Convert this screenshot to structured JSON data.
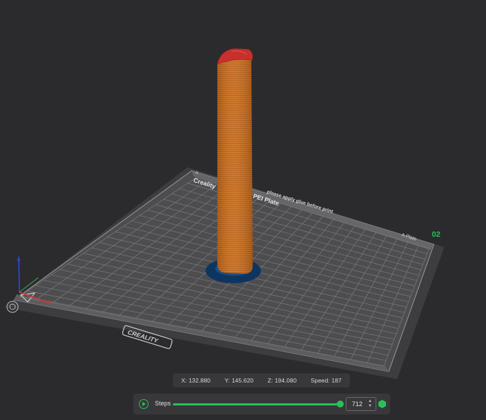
{
  "plate": {
    "brand_top": "Creality",
    "brand_top_suffix": "PEI Plate",
    "glue_note": "please apply glue before print",
    "plate_number": "02",
    "side_label": "A Plate",
    "bottom_logo": "CREALITY",
    "corner_label": "A"
  },
  "readout": {
    "x": "X: 132.880",
    "y": "Y: 145.620",
    "z": "Z: 194.080",
    "speed": "Speed: 187"
  },
  "steps": {
    "label": "Steps",
    "value": "712",
    "progress": 1.0
  },
  "colors": {
    "background": "#2b2b2d",
    "plate": "#505053",
    "grid": "#7a7a7d",
    "model_wall": "#d8781e",
    "model_top": "#c8302d",
    "model_base": "#0d3a66",
    "accent": "#27c15a"
  },
  "icons": [
    "play-icon",
    "axes-gizmo-icon",
    "layer-icon",
    "spinner-icon"
  ]
}
